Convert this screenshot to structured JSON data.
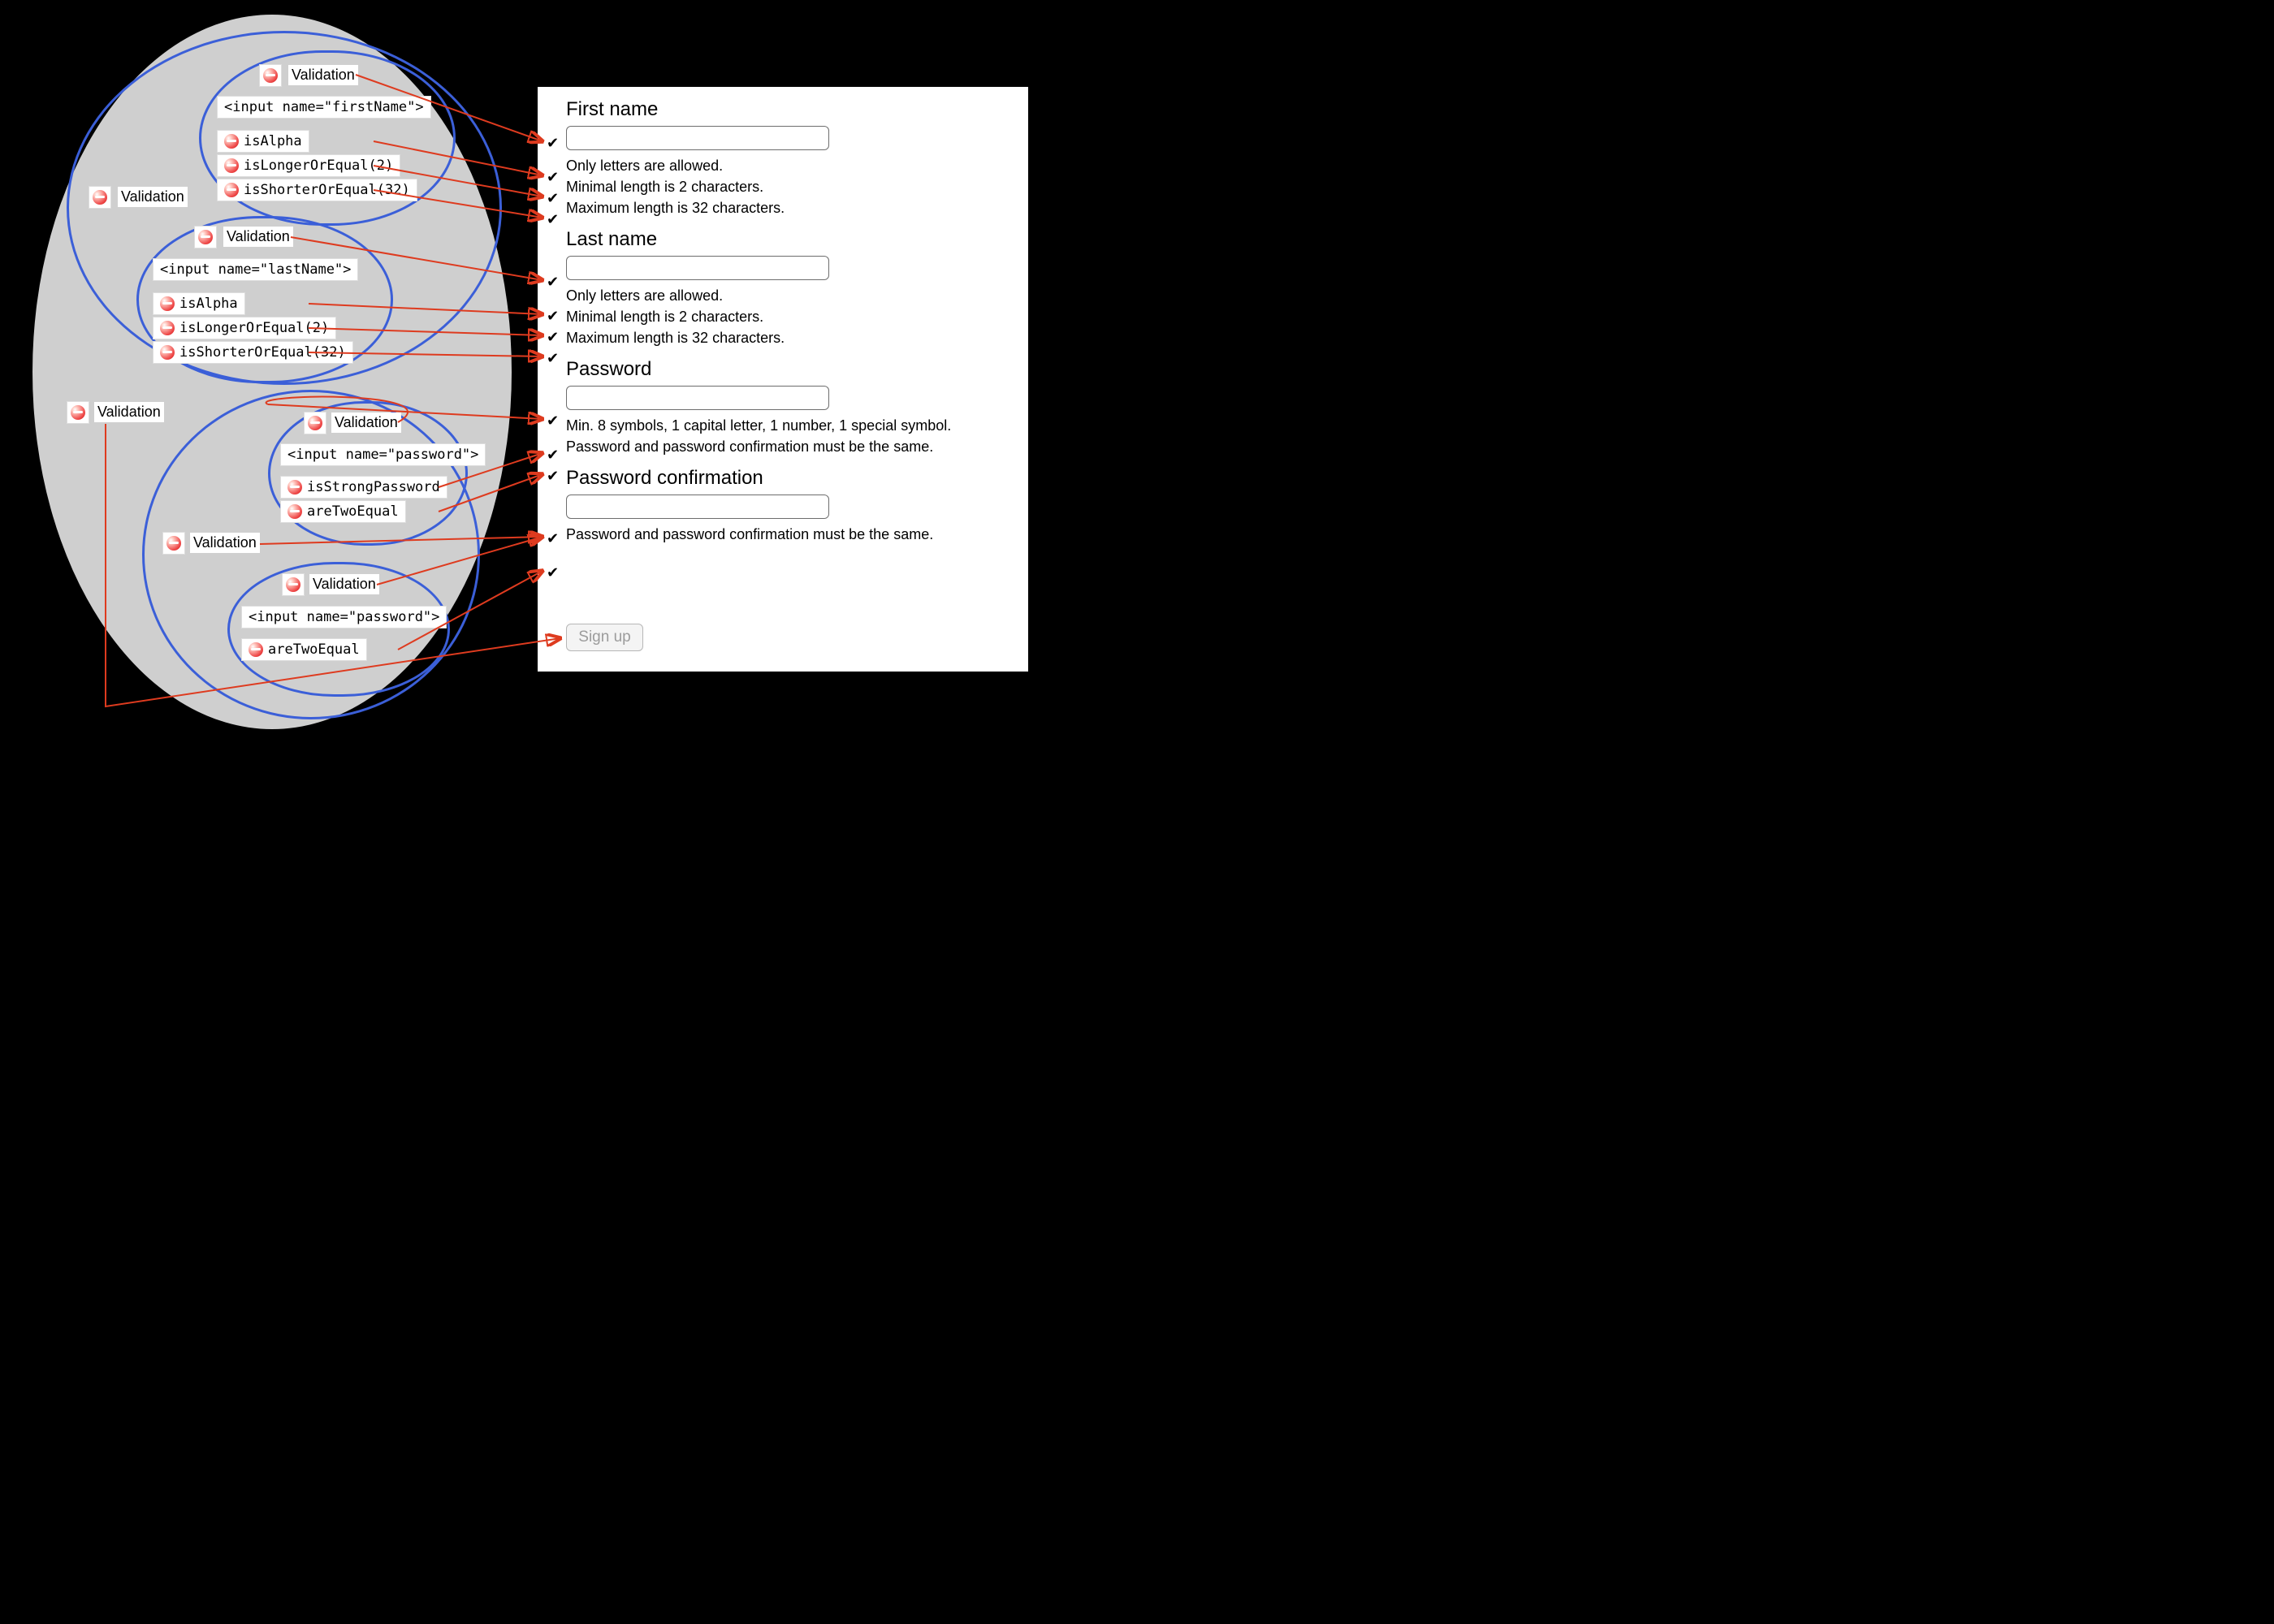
{
  "labels": {
    "validation": "Validation"
  },
  "tree": {
    "firstName": {
      "input": "<input name=\"firstName\">",
      "rules": [
        "isAlpha",
        "isLongerOrEqual(2)",
        "isShorterOrEqual(32)"
      ]
    },
    "lastName": {
      "input": "<input name=\"lastName\">",
      "rules": [
        "isAlpha",
        "isLongerOrEqual(2)",
        "isShorterOrEqual(32)"
      ]
    },
    "password": {
      "input": "<input name=\"password\">",
      "rules": [
        "isStrongPassword",
        "areTwoEqual"
      ]
    },
    "passwordConfirm": {
      "input": "<input name=\"password\">",
      "rules": [
        "areTwoEqual"
      ]
    }
  },
  "form": {
    "firstName": {
      "heading": "First name",
      "messages": [
        "Only letters are allowed.",
        "Minimal length is 2 characters.",
        "Maximum length is 32 characters."
      ]
    },
    "lastName": {
      "heading": "Last name",
      "messages": [
        "Only letters are allowed.",
        "Minimal length is 2 characters.",
        "Maximum length is 32 characters."
      ]
    },
    "password": {
      "heading": "Password",
      "messages": [
        "Min. 8 symbols, 1 capital letter, 1 number, 1 special symbol.",
        "Password and password confirmation must be the same."
      ]
    },
    "passwordConfirm": {
      "heading": "Password confirmation",
      "messages": [
        "Password and password confirmation must be the same."
      ]
    },
    "submit": "Sign up"
  }
}
